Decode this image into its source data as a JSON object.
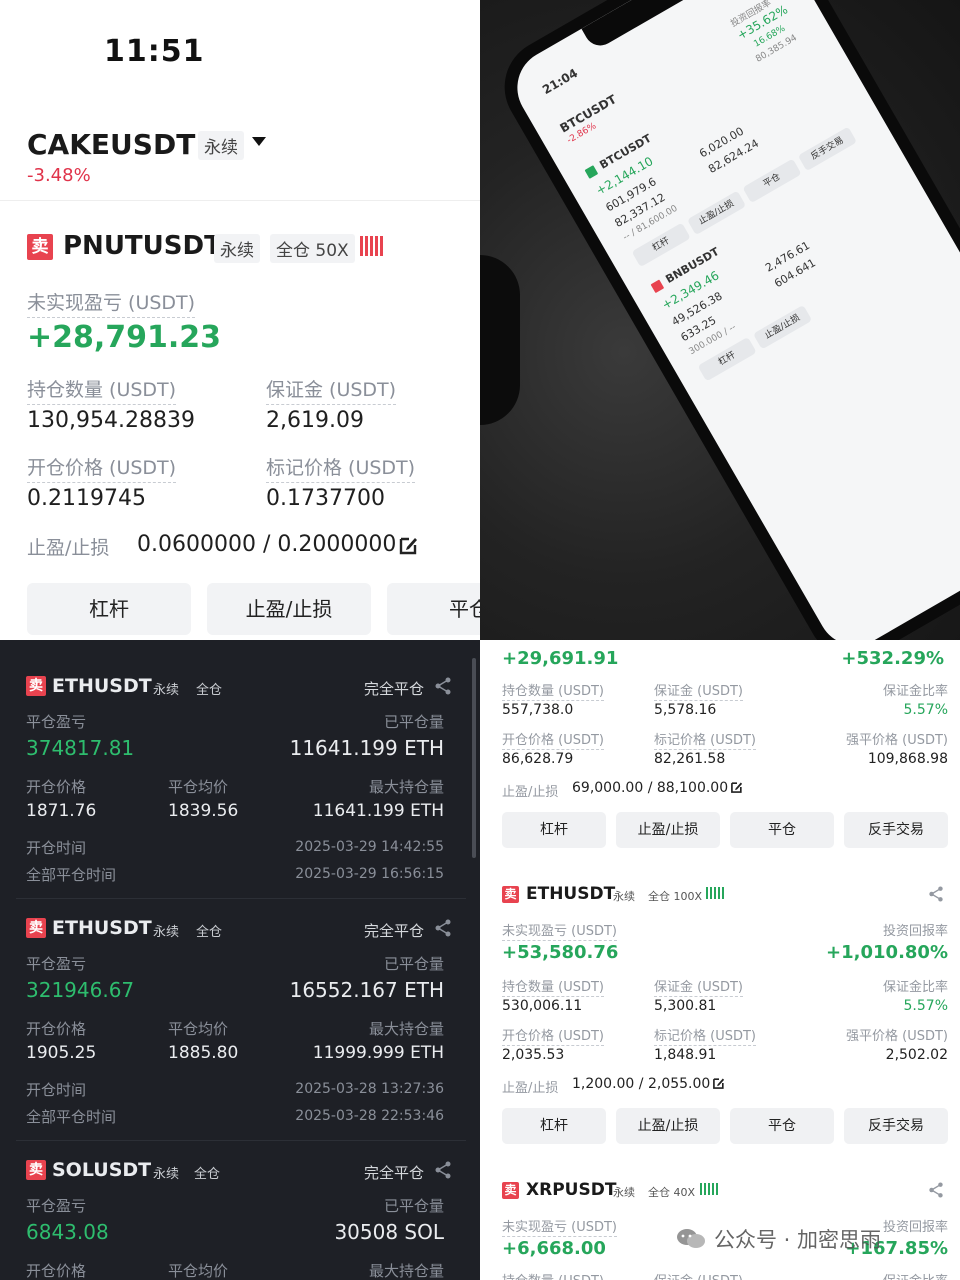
{
  "top_left": {
    "time": "11:51",
    "pair": "CAKEUSDT",
    "pair_tag": "永续",
    "pair_change": "-3.48%",
    "position": {
      "side": "卖",
      "symbol": "PNUTUSDT",
      "tag_perpetual": "永续",
      "tag_margin": "全仓 50X",
      "unrealized_label": "未实现盈亏 (USDT)",
      "unrealized_value": "+28,791.23",
      "qty_label": "持仓数量 (USDT)",
      "qty_value": "130,954.28839",
      "margin_label": "保证金 (USDT)",
      "margin_value": "2,619.09",
      "entry_label": "开仓价格 (USDT)",
      "entry_value": "0.2119745",
      "mark_label": "标记价格 (USDT)",
      "mark_value": "0.1737700",
      "tpsl_label": "止盈/止损",
      "tpsl_value": "0.0600000 / 0.2000000",
      "buttons": [
        "杠杆",
        "止盈/止损",
        "平仓"
      ]
    }
  },
  "top_right_photo": {
    "time": "21:04",
    "pair": "BTCUSDT",
    "pair_change": "-2.86%",
    "roi_label": "投资回报率",
    "roi_value": "+35.62%",
    "margin_ratio": "16.68%",
    "liq_price": "80,385.94",
    "pos1": {
      "symbol": "BTCUSDT",
      "pnl": "+2,144.10",
      "qty": "601,979.6",
      "margin": "6,020.00",
      "entry": "82,337.12",
      "mark": "82,624.24",
      "tpsl": "-- / 81,600.00"
    },
    "pos2": {
      "symbol": "BNBUSDT",
      "pnl": "+2,349.46",
      "qty": "49,526.38",
      "margin": "2,476.61",
      "entry": "633.25",
      "mark": "604.641",
      "tpsl": "300.000 / --"
    },
    "buttons": [
      "杠杆",
      "止盈/止损",
      "平仓",
      "反手交易"
    ]
  },
  "history": [
    {
      "side": "卖",
      "symbol": "ETHUSDT",
      "tag1": "永续",
      "tag2": "全仓",
      "status": "完全平仓",
      "pnl_label": "平仓盈亏",
      "pnl_value": "374817.81",
      "closed_label": "已平仓量",
      "closed_value": "11641.199 ETH",
      "open_label": "开仓价格",
      "open_value": "1871.76",
      "avg_label": "平仓均价",
      "avg_value": "1839.56",
      "max_label": "最大持仓量",
      "max_value": "11641.199 ETH",
      "open_time_label": "开仓时间",
      "open_time": "2025-03-29 14:42:55",
      "close_time_label": "全部平仓时间",
      "close_time": "2025-03-29 16:56:15"
    },
    {
      "side": "卖",
      "symbol": "ETHUSDT",
      "tag1": "永续",
      "tag2": "全仓",
      "status": "完全平仓",
      "pnl_label": "平仓盈亏",
      "pnl_value": "321946.67",
      "closed_label": "已平仓量",
      "closed_value": "16552.167 ETH",
      "open_label": "开仓价格",
      "open_value": "1905.25",
      "avg_label": "平仓均价",
      "avg_value": "1885.80",
      "max_label": "最大持仓量",
      "max_value": "11999.999 ETH",
      "open_time_label": "开仓时间",
      "open_time": "2025-03-28 13:27:36",
      "close_time_label": "全部平仓时间",
      "close_time": "2025-03-28 22:53:46"
    },
    {
      "side": "卖",
      "symbol": "SOLUSDT",
      "tag1": "永续",
      "tag2": "全仓",
      "status": "完全平仓",
      "pnl_label": "平仓盈亏",
      "pnl_value": "6843.08",
      "closed_label": "已平仓量",
      "closed_value": "30508 SOL",
      "open_label": "开仓价格",
      "avg_label": "平仓均价",
      "max_label": "最大持仓量"
    }
  ],
  "bottom_right": {
    "first": {
      "pnl_value": "+29,691.91",
      "roi_value": "+532.29%",
      "qty_label": "持仓数量 (USDT)",
      "qty_value": "557,738.0",
      "margin_label": "保证金 (USDT)",
      "margin_value": "5,578.16",
      "margin_ratio_label": "保证金比率",
      "margin_ratio_value": "5.57%",
      "entry_label": "开仓价格 (USDT)",
      "entry_value": "86,628.79",
      "mark_label": "标记价格 (USDT)",
      "mark_value": "82,261.58",
      "liq_label": "强平价格 (USDT)",
      "liq_value": "109,868.98",
      "tpsl_label": "止盈/止损",
      "tpsl_value": "69,000.00 / 88,100.00"
    },
    "eth": {
      "side": "卖",
      "symbol": "ETHUSDT",
      "tag1": "永续",
      "tag2": "全仓 100X",
      "pnl_label": "未实现盈亏 (USDT)",
      "pnl_value": "+53,580.76",
      "roi_label": "投资回报率",
      "roi_value": "+1,010.80%",
      "qty_label": "持仓数量 (USDT)",
      "qty_value": "530,006.11",
      "margin_label": "保证金 (USDT)",
      "margin_value": "5,300.81",
      "margin_ratio_label": "保证金比率",
      "margin_ratio_value": "5.57%",
      "entry_label": "开仓价格 (USDT)",
      "entry_value": "2,035.53",
      "mark_label": "标记价格 (USDT)",
      "mark_value": "1,848.91",
      "liq_label": "强平价格 (USDT)",
      "liq_value": "2,502.02",
      "tpsl_label": "止盈/止损",
      "tpsl_value": "1,200.00 / 2,055.00"
    },
    "xrp": {
      "side": "卖",
      "symbol": "XRPUSDT",
      "tag1": "永续",
      "tag2": "全仓 40X",
      "pnl_label": "未实现盈亏 (USDT)",
      "pnl_value": "+6,668.00",
      "roi_label": "投资回报率",
      "roi_value": "+167.85%",
      "qty_label": "持仓数量 (USDT)",
      "margin_label": "保证金 (USDT)",
      "margin_ratio_label": "保证金比率"
    },
    "buttons": [
      "杠杆",
      "止盈/止损",
      "平仓",
      "反手交易"
    ],
    "watermark": "公众号 · 加密思雨"
  }
}
